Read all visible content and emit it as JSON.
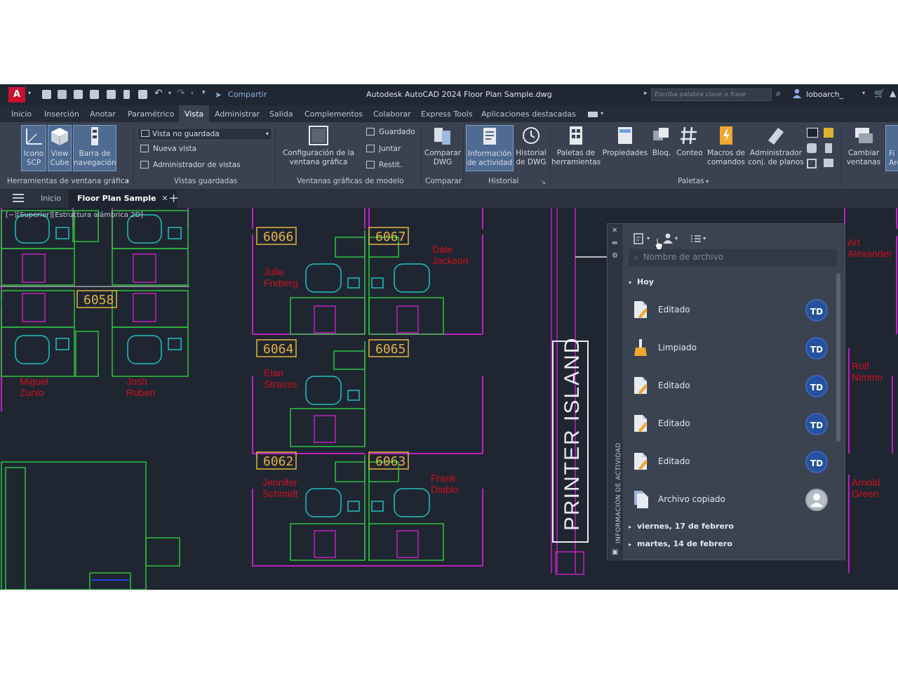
{
  "window": {
    "title": "Autodesk AutoCAD 2024   Floor Plan Sample.dwg",
    "app_letter": "A",
    "share_label": "Compartir",
    "search_placeholder": "Escriba palabra clave o frase",
    "user_name": "loboarch_"
  },
  "ribbon_tabs": [
    "Inicio",
    "Inserción",
    "Anotar",
    "Paramétrico",
    "Vista",
    "Administrar",
    "Salida",
    "Complementos",
    "Colaborar",
    "Express Tools",
    "Aplicaciones destacadas"
  ],
  "active_tab": "Vista",
  "ribbon": {
    "ucs_icon": "Icono SCP",
    "view_cube": "View Cube",
    "nav_bar": "Barra de navegación",
    "group_viewport_tools": "Herramientas de ventana gráfica",
    "view_dropdown": "Vista no guardada",
    "new_view": "Nueva vista",
    "view_manager": "Administrador de vistas",
    "group_saved_views": "Vistas guardadas",
    "viewport_config": "Configuración de la ventana gráfica",
    "saved": "Guardado",
    "join": "Juntar",
    "restore": "Restit.",
    "group_model_viewports": "Ventanas gráficas de modelo",
    "compare_dwg": "Comparar DWG",
    "group_compare": "Comparar",
    "activity_info": "Información de actividad",
    "dwg_history": "Historial de DWG",
    "group_history": "Historial",
    "tool_palettes": "Paletas de herramientas",
    "properties": "Propiedades",
    "block": "Bloq.",
    "count": "Conteo",
    "command_macros": "Macros de comandos",
    "sheet_set_manager": "Administrador conj. de planos",
    "group_palettes": "Paletas",
    "switch_windows": "Cambiar ventanas",
    "partial_fi": "Fi",
    "partial_ar": "Arc"
  },
  "file_tabs": {
    "start": "Inicio",
    "current": "Floor Plan Sample",
    "close_glyph": "✕",
    "add_glyph": "+"
  },
  "viewport_label": "[−][Superior][Estructura alámbrica 2D]",
  "plan": {
    "rooms": [
      "6066",
      "6067",
      "6058",
      "6064",
      "6065",
      "6062",
      "6063"
    ],
    "people": [
      [
        "Julie",
        "Freberg"
      ],
      [
        "Dale",
        "Jackson"
      ],
      [
        "Miguel",
        "Zunio"
      ],
      [
        "Josh",
        "Ruben"
      ],
      [
        "Elan",
        "Strauss"
      ],
      [
        "Jennifer",
        "Schmidt"
      ],
      [
        "Frank",
        "Diablo"
      ],
      [
        "Art",
        "Alexander"
      ],
      [
        "Rolf",
        "Nimmo"
      ],
      [
        "Arnold",
        "Green"
      ]
    ],
    "printer_label": "PRINTER ISLAND"
  },
  "activity_palette": {
    "vertical_title": "INFORMACIÓN DE ACTIVIDAD",
    "search_placeholder": "Nombre de archivo",
    "group_today": "Hoy",
    "items": [
      {
        "label": "Editado",
        "avatar": "TD",
        "icon": "edit-document-icon"
      },
      {
        "label": "Limpiado",
        "avatar": "TD",
        "icon": "purge-broom-icon"
      },
      {
        "label": "Editado",
        "avatar": "TD",
        "icon": "edit-document-icon"
      },
      {
        "label": "Editado",
        "avatar": "TD",
        "icon": "edit-document-icon"
      },
      {
        "label": "Editado",
        "avatar": "TD",
        "icon": "edit-document-icon"
      },
      {
        "label": "Archivo copiado",
        "avatar": "",
        "icon": "copy-file-icon"
      }
    ],
    "group_friday": "viernes, 17 de febrero",
    "group_tuesday": "martes, 14 de febrero"
  },
  "colors": {
    "walls": "#c020c0",
    "desks": "#30c040",
    "chairs": "#20c0c0",
    "room_numbers": "#e5b342",
    "person_names": "#d01020",
    "avatar": "#25519e"
  }
}
